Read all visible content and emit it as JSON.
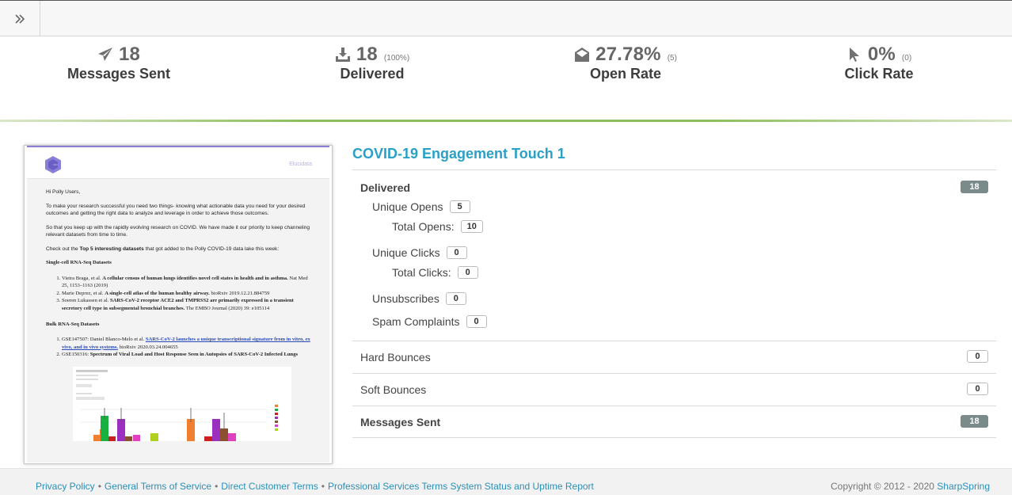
{
  "stats": [
    {
      "icon": "paper-plane-icon",
      "value": "18",
      "sub": "",
      "label": "Messages Sent"
    },
    {
      "icon": "download-icon",
      "value": "18",
      "sub": "(100%)",
      "label": "Delivered"
    },
    {
      "icon": "open-envelope-icon",
      "value": "27.78%",
      "sub": "(5)",
      "label": "Open Rate"
    },
    {
      "icon": "cursor-icon",
      "value": "0%",
      "sub": "(0)",
      "label": "Click Rate"
    }
  ],
  "email_preview": {
    "brand": "Elucidata",
    "greeting": "Hi Polly Users,",
    "para1": "To make your research successful you need two things- knowing what actionable data you need for your desired outcomes and getting the right data to analyze and leverage in order to achieve those outcomes.",
    "para2": "So that you keep up with the rapidly evolving research on COVID. We have made it our priority to keep channeling relevant datasets from time to time.",
    "para3_pre": "Check out the ",
    "para3_bold": "Top 5 interesting datasets",
    "para3_post": " that got added to the Polly COVID-19 data lake this week:",
    "section1": "Single-cell RNA-Seq Datasets",
    "s1_items": [
      {
        "a": "Vieira Braga, et al. ",
        "b": "A cellular census of human lungs identifies novel cell states in health and in asthma.",
        "c": " Nat Med 25, 1153–1163 (2019)"
      },
      {
        "a": "Marie Deprez, et al. ",
        "b": "A single-cell atlas of the human healthy airway.",
        "c": " bioRxiv 2019.12.21.884759"
      },
      {
        "a": "Soeren Lukassen et al. ",
        "b": "SARS-CoV-2 receptor ACE2 and TMPRSS2 are primarily expressed in a transient secretory cell type in subsegmental bronchial branches.",
        "c": " The EMBO Journal (2020) 39: e105114"
      }
    ],
    "section2": "Bulk RNA-Seq Datasets",
    "s2_items": [
      {
        "a": "GSE147507: Daniel Blanco-Melo et al. ",
        "b": "SARS-CoV-2 launches a unique transcriptional signature from in vitro, ex vivo, and in vivo systems.",
        "c": " bioRxiv 2020.03.24.004655"
      },
      {
        "a": "GSE150316: ",
        "b": "Spectrum of Viral Load and Host Response Seen in Autopsies of SARS-CoV-2 Infected Lungs",
        "c": ""
      }
    ]
  },
  "campaign_title": "COVID-19 Engagement Touch 1",
  "table": {
    "delivered_label": "Delivered",
    "delivered_value": "18",
    "unique_opens_label": "Unique Opens",
    "unique_opens_value": "5",
    "total_opens_label": "Total Opens:",
    "total_opens_value": "10",
    "unique_clicks_label": "Unique Clicks",
    "unique_clicks_value": "0",
    "total_clicks_label": "Total Clicks:",
    "total_clicks_value": "0",
    "unsubscribes_label": "Unsubscribes",
    "unsubscribes_value": "0",
    "spam_label": "Spam Complaints",
    "spam_value": "0",
    "hard_bounces_label": "Hard Bounces",
    "hard_bounces_value": "0",
    "soft_bounces_label": "Soft Bounces",
    "soft_bounces_value": "0",
    "messages_sent_label": "Messages Sent",
    "messages_sent_value": "18"
  },
  "footer": {
    "link1": "Privacy Policy",
    "link2": "General Terms of Service",
    "link3": "Direct Customer Terms",
    "link4": "Professional Services Terms",
    "link5": "System Status and Uptime Report",
    "copyright": "Copyright © 2012 - 2020",
    "brand": "SharpSpring"
  },
  "colors": {
    "accent": "#2aa0c7",
    "divider": "#8cbf5b",
    "badge": "#7b8b8a"
  }
}
